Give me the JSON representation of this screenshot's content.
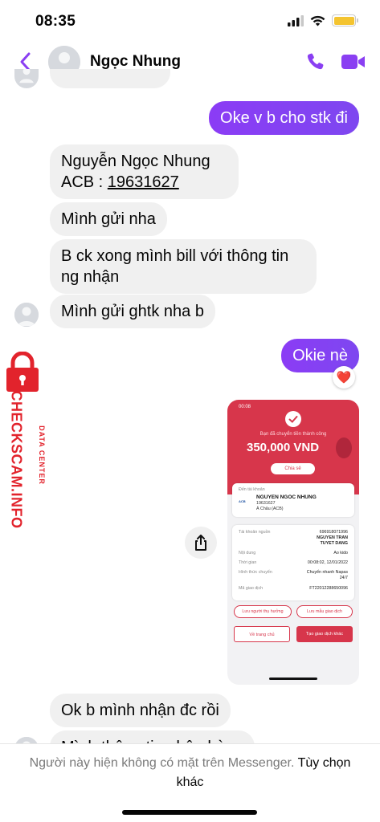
{
  "status_bar": {
    "time": "08:35"
  },
  "header": {
    "contact_name": "Ngọc Nhung"
  },
  "messages": [
    {
      "side": "out",
      "text": "Oke v b cho stk đi"
    },
    {
      "side": "in",
      "line1": "Nguyễn Ngọc Nhung",
      "line2_prefix": "ACB : ",
      "line2_number": "19631627"
    },
    {
      "side": "in",
      "text": "Mình gửi nha"
    },
    {
      "side": "in",
      "line1": "B ck xong mình bill với thông tin",
      "line2": "ng nhận"
    },
    {
      "side": "in",
      "text": "Mình gửi ghtk nha b"
    },
    {
      "side": "out",
      "text": "Okie nè"
    },
    {
      "side": "in",
      "text": "Ok b mình nhận đc rồi"
    },
    {
      "side": "in",
      "text": "Mình thông tin nhận hàng"
    }
  ],
  "reaction": {
    "emoji": "❤️"
  },
  "receipt": {
    "time": "00:08",
    "subtitle": "Bạn đã chuyển tiền thành công",
    "amount": "350,000 VND",
    "share_label": "Chia sẻ",
    "to_account_label": "Đến tài khoản",
    "bank_logo": "ACB",
    "recipient_name": "NGUYEN NGOC NHUNG",
    "recipient_account": "19631627",
    "recipient_bank": "Á Châu (ACB)",
    "rows": [
      {
        "label": "Tài khoản nguồn",
        "value": "696918071996"
      },
      {
        "label": "",
        "value": "NGUYEN TRAN"
      },
      {
        "label": "",
        "value": "TUYET DANG"
      },
      {
        "label": "Nội dung",
        "value": "Ao kido"
      },
      {
        "label": "Thời gian",
        "value": "00:08:02, 12/01/2022"
      },
      {
        "label": "Hình thức chuyển",
        "value": "Chuyển nhanh Napas"
      },
      {
        "label": "",
        "value": "24/7"
      },
      {
        "label": "Mã giao dịch",
        "value": "FT22012288650096"
      }
    ],
    "save_beneficiary": "Lưu người thụ hưởng",
    "save_template": "Lưu mẫu giao dịch",
    "home_button": "Về trang chủ",
    "new_transaction_button": "Tạo giao dịch khác"
  },
  "watermark": {
    "main": "CHECKSCAM.INFO",
    "sub": "DATA CENTER"
  },
  "bottom": {
    "notice": "Người này hiện không có mặt trên Messenger. ",
    "action": "Tùy chọn khác"
  },
  "colors": {
    "accent": "#8a3ff2",
    "incoming_bubble": "#f0f0f0",
    "watermark": "#e2232c",
    "receipt_brand": "#d7364b"
  }
}
